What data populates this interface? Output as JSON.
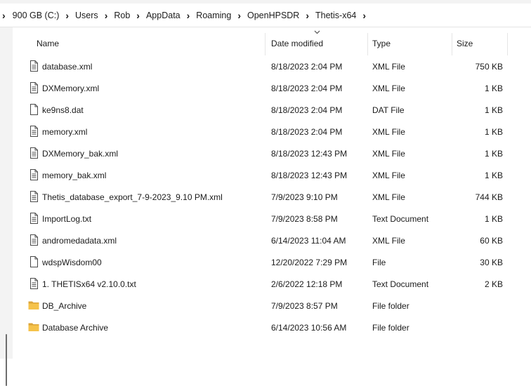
{
  "breadcrumb": {
    "items": [
      "900 GB (C:)",
      "Users",
      "Rob",
      "AppData",
      "Roaming",
      "OpenHPSDR",
      "Thetis-x64"
    ]
  },
  "columns": {
    "name": "Name",
    "date_modified": "Date modified",
    "type": "Type",
    "size": "Size"
  },
  "sort": {
    "column": "date_modified",
    "direction": "descending"
  },
  "files": [
    {
      "name": "database.xml",
      "date": "8/18/2023 2:04 PM",
      "type": "XML File",
      "size": "750 KB",
      "icon": "text-file-icon"
    },
    {
      "name": "DXMemory.xml",
      "date": "8/18/2023 2:04 PM",
      "type": "XML File",
      "size": "1 KB",
      "icon": "text-file-icon"
    },
    {
      "name": "ke9ns8.dat",
      "date": "8/18/2023 2:04 PM",
      "type": "DAT File",
      "size": "1 KB",
      "icon": "blank-file-icon"
    },
    {
      "name": "memory.xml",
      "date": "8/18/2023 2:04 PM",
      "type": "XML File",
      "size": "1 KB",
      "icon": "text-file-icon"
    },
    {
      "name": "DXMemory_bak.xml",
      "date": "8/18/2023 12:43 PM",
      "type": "XML File",
      "size": "1 KB",
      "icon": "text-file-icon"
    },
    {
      "name": "memory_bak.xml",
      "date": "8/18/2023 12:43 PM",
      "type": "XML File",
      "size": "1 KB",
      "icon": "text-file-icon"
    },
    {
      "name": "Thetis_database_export_7-9-2023_9.10 PM.xml",
      "date": "7/9/2023 9:10 PM",
      "type": "XML File",
      "size": "744 KB",
      "icon": "text-file-icon"
    },
    {
      "name": "ImportLog.txt",
      "date": "7/9/2023 8:58 PM",
      "type": "Text Document",
      "size": "1 KB",
      "icon": "text-file-icon"
    },
    {
      "name": "andromedadata.xml",
      "date": "6/14/2023 11:04 AM",
      "type": "XML File",
      "size": "60 KB",
      "icon": "text-file-icon"
    },
    {
      "name": "wdspWisdom00",
      "date": "12/20/2022 7:29 PM",
      "type": "File",
      "size": "30 KB",
      "icon": "blank-file-icon"
    },
    {
      "name": "1. THETISx64 v2.10.0.txt",
      "date": "2/6/2022 12:18 PM",
      "type": "Text Document",
      "size": "2 KB",
      "icon": "text-file-icon"
    },
    {
      "name": "DB_Archive",
      "date": "7/9/2023 8:57 PM",
      "type": "File folder",
      "size": "",
      "icon": "folder-icon"
    },
    {
      "name": "Database Archive",
      "date": "6/14/2023 10:56 AM",
      "type": "File folder",
      "size": "",
      "icon": "folder-icon"
    }
  ],
  "colors": {
    "folder": "#f5c24a",
    "folder_dark": "#dca53a",
    "border": "#e5e5e5",
    "pane_bg": "#f3f3f3"
  }
}
